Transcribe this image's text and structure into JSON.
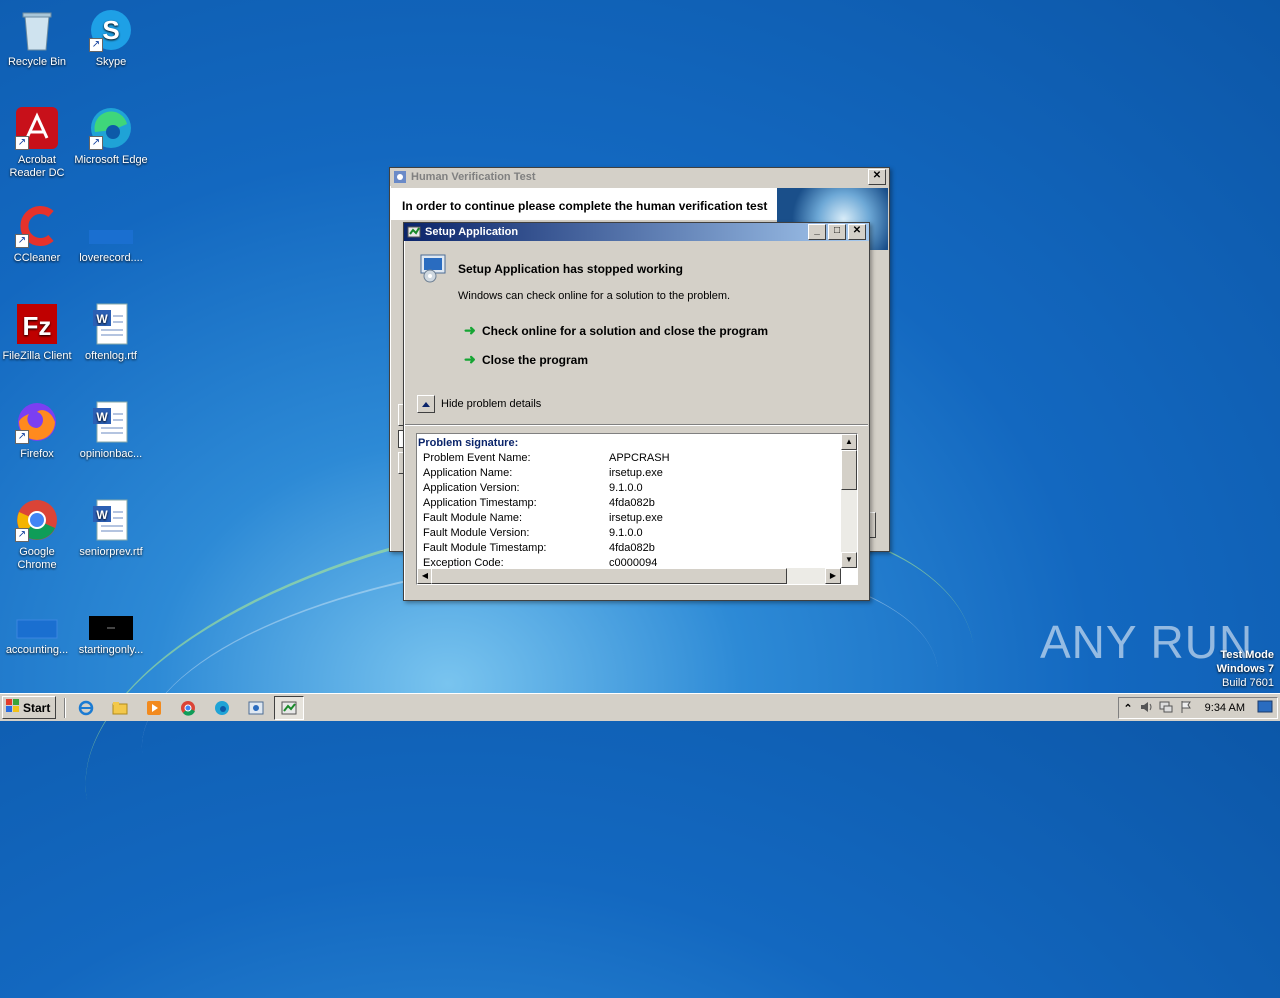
{
  "desktop": {
    "icons": [
      {
        "label": "Recycle Bin",
        "icon": "recycle-bin-icon"
      },
      {
        "label": "Skype",
        "icon": "skype-icon"
      },
      {
        "label": "Acrobat Reader DC",
        "icon": "acrobat-icon"
      },
      {
        "label": "Microsoft Edge",
        "icon": "edge-icon"
      },
      {
        "label": "CCleaner",
        "icon": "ccleaner-icon"
      },
      {
        "label": "loverecord....",
        "icon": "file-icon"
      },
      {
        "label": "FileZilla Client",
        "icon": "filezilla-icon"
      },
      {
        "label": "oftenlog.rtf",
        "icon": "word-doc-icon"
      },
      {
        "label": "Firefox",
        "icon": "firefox-icon"
      },
      {
        "label": "opinionbac...",
        "icon": "word-doc-icon"
      },
      {
        "label": "Google Chrome",
        "icon": "chrome-icon"
      },
      {
        "label": "seniorprev.rtf",
        "icon": "word-doc-icon"
      },
      {
        "label": "accounting...",
        "icon": "file-icon"
      },
      {
        "label": "startingonly...",
        "icon": "black-file-icon"
      }
    ],
    "watermark": {
      "brand": "ANY RUN",
      "mode": "Test Mode",
      "os": "Windows 7",
      "build": "Build 7601"
    }
  },
  "hv_window": {
    "title": "Human Verification Test",
    "heading": "In order to continue please complete the human verification test",
    "close_glyph": "✕"
  },
  "crash_dialog": {
    "title": "Setup Application",
    "heading": "Setup Application has stopped working",
    "subtext": "Windows can check online for a solution to the problem.",
    "option_check": "Check online for a solution and close the program",
    "option_close": "Close the program",
    "toggle_label": "Hide problem details",
    "details": {
      "header": "Problem signature:",
      "rows": [
        {
          "k": "Problem Event Name:",
          "v": "APPCRASH"
        },
        {
          "k": "Application Name:",
          "v": "irsetup.exe"
        },
        {
          "k": "Application Version:",
          "v": "9.1.0.0"
        },
        {
          "k": "Application Timestamp:",
          "v": "4fda082b"
        },
        {
          "k": "Fault Module Name:",
          "v": "irsetup.exe"
        },
        {
          "k": "Fault Module Version:",
          "v": "9.1.0.0"
        },
        {
          "k": "Fault Module Timestamp:",
          "v": "4fda082b"
        },
        {
          "k": "Exception Code:",
          "v": "c0000094"
        }
      ]
    }
  },
  "taskbar": {
    "start_label": "Start",
    "clock": "9:34 AM",
    "apps": [
      "ie-icon",
      "explorer-icon",
      "media-player-icon",
      "chrome-icon",
      "edge-icon",
      "setup-icon",
      "crash-dialog-icon"
    ]
  },
  "colors": {
    "titlebar_active": "#0a246a",
    "titlebar_inactive": "#d4d0c8",
    "arrow": "#16a534",
    "desktop": "#1368c0"
  }
}
